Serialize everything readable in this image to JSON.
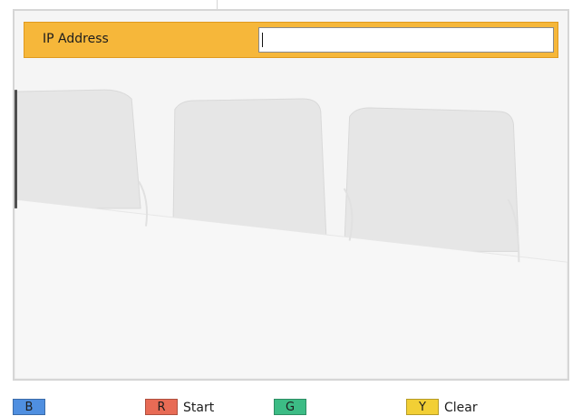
{
  "screen": {
    "title_label": "IP Address",
    "input_value": ""
  },
  "footer": {
    "keys": [
      {
        "letter": "B",
        "action": ""
      },
      {
        "letter": "R",
        "action": "Start"
      },
      {
        "letter": "G",
        "action": ""
      },
      {
        "letter": "Y",
        "action": "Clear"
      }
    ]
  },
  "colors": {
    "header": "#f6b73a",
    "header_border": "#e09a1f",
    "key_b": "#4f8fe0",
    "key_r": "#e86b55",
    "key_g": "#3cbc85",
    "key_y": "#f2cf35"
  },
  "icons": [
    "chair-background-image"
  ]
}
